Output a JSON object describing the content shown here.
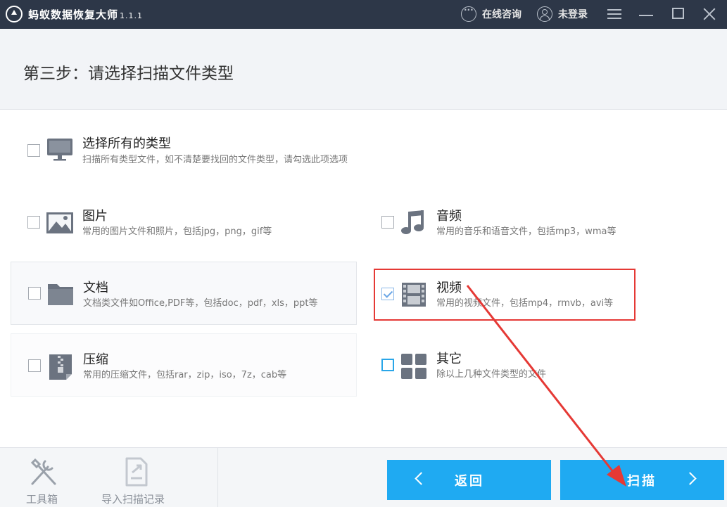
{
  "app": {
    "title": "蚂蚁数据恢复大师",
    "version": "1.1.1"
  },
  "titlebar": {
    "online_consult": "在线咨询",
    "login_status": "未登录"
  },
  "step": {
    "title": "第三步：请选择扫描文件类型"
  },
  "options": {
    "all": {
      "title": "选择所有的类型",
      "desc": "扫描所有类型文件，如不清楚要找回的文件类型，请勾选此项选项",
      "checked": false
    },
    "image": {
      "title": "图片",
      "desc": "常用的图片文件和照片，包括jpg，png，gif等",
      "checked": false
    },
    "audio": {
      "title": "音频",
      "desc": "常用的音乐和语音文件，包括mp3，wma等",
      "checked": false
    },
    "doc": {
      "title": "文档",
      "desc": "文档类文件如Office,PDF等，包括doc，pdf，xls，ppt等",
      "checked": false
    },
    "video": {
      "title": "视频",
      "desc": "常用的视频文件，包括mp4，rmvb，avi等",
      "checked": true
    },
    "archive": {
      "title": "压缩",
      "desc": "常用的压缩文件，包括rar，zip，iso，7z，cab等",
      "checked": false
    },
    "other": {
      "title": "其它",
      "desc": "除以上几种文件类型的文件",
      "checked": false
    }
  },
  "tools": {
    "toolbox": "工具箱",
    "import_scan": "导入扫描记录"
  },
  "buttons": {
    "back": "返回",
    "scan": "扫描"
  },
  "colors": {
    "titlebar": "#2d3748",
    "primary_button": "#1faaf2",
    "annotation": "#e53935"
  }
}
